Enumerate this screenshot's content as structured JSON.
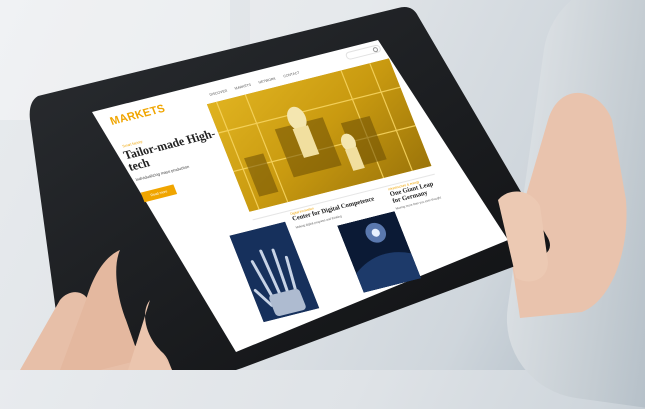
{
  "site": {
    "logo": "MARKETS",
    "nav": [
      "Discover",
      "Markets",
      "Network",
      "Contact"
    ],
    "hero": {
      "eyebrow": "Smart factory",
      "title": "Tailor-made High-tech",
      "subtitle": "Individualizing mass production",
      "button_label": "Read more"
    },
    "cards": [
      {
        "eyebrow": "Digital innovation",
        "title": "Center for Digital Competence",
        "subtitle": "Making digital progress and thinking"
      },
      {
        "eyebrow": "Infrastructure & energy",
        "title": "One Giant Leap for Germany",
        "subtitle": "Moving more than you ever thought"
      }
    ]
  },
  "colors": {
    "accent": "#f0a500",
    "tablet_frame": "#1b1d20",
    "hero_image": "#d2a214",
    "card_image_dark": "#13284f"
  },
  "icons": [
    "search-icon"
  ]
}
